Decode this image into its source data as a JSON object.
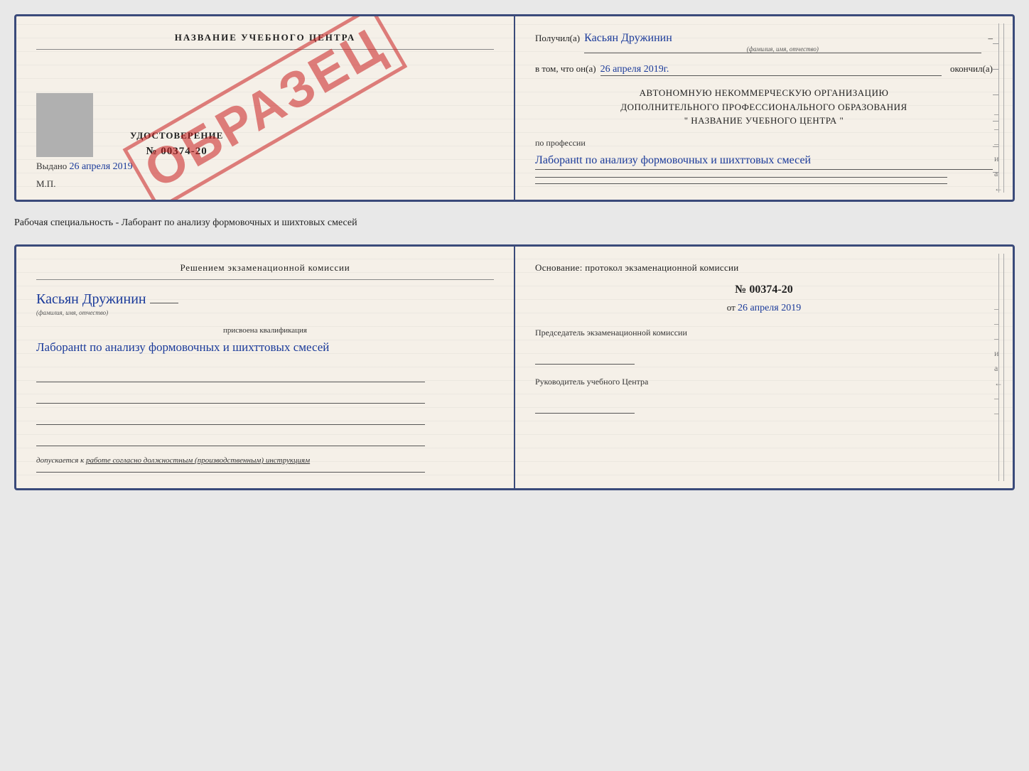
{
  "page": {
    "background": "#e8e8e8"
  },
  "top_card": {
    "left": {
      "title": "НАЗВАНИЕ УЧЕБНОГО ЦЕНТРА",
      "stamp": "ОБРАЗЕЦ",
      "cert_label": "УДОСТОВЕРЕНИЕ",
      "cert_number": "№ 00374-20",
      "issued_label": "Выдано",
      "issued_date": "26 апреля 2019",
      "mp_label": "М.П."
    },
    "right": {
      "received_label": "Получил(а)",
      "received_name": "Касьян Дружинин",
      "name_sub": "(фамилия, имя, отчество)",
      "completed_prefix": "в том, что он(а)",
      "completed_date": "26 апреля 2019г.",
      "completed_suffix": "окончил(а)",
      "org_line1": "АВТОНОМНУЮ НЕКОММЕРЧЕСКУЮ ОРГАНИЗАЦИЮ",
      "org_line2": "ДОПОЛНИТЕЛЬНОГО ПРОФЕССИОНАЛЬНОГО ОБРАЗОВАНИЯ",
      "org_line3": "\"  НАЗВАНИЕ УЧЕБНОГО ЦЕНТРА  \"",
      "profession_label": "по профессии",
      "profession_text": "Лаборанtt по анализу формовочных и шихттовых смесей",
      "side_chars": [
        "и",
        "а",
        "←",
        "–",
        "–",
        "–",
        "–"
      ]
    }
  },
  "specialty_line": "Рабочая специальность - Лаборант по анализу формовочных и шихтовых смесей",
  "bottom_card": {
    "left": {
      "heading": "Решением  экзаменационной  комиссии",
      "person_name": "Касьян  Дружинин",
      "name_sub": "(фамилия, имя, отчество)",
      "qualification_label": "присвоена квалификация",
      "qualification_text": "Лаборанtt по анализу формовочных и шихттовых смесей",
      "allowed_label": "допускается к",
      "allowed_text": "работе согласно должностным (производственным) инструкциям"
    },
    "right": {
      "osnov_label": "Основание: протокол экзаменационной  комиссии",
      "protocol_number": "№  00374-20",
      "date_prefix": "от",
      "date_value": "26 апреля 2019",
      "chairman_label": "Председатель экзаменационной комиссии",
      "rukov_label": "Руководитель учебного Центра",
      "side_chars": [
        "и",
        "а",
        "←",
        "–",
        "–",
        "–",
        "–"
      ]
    }
  }
}
